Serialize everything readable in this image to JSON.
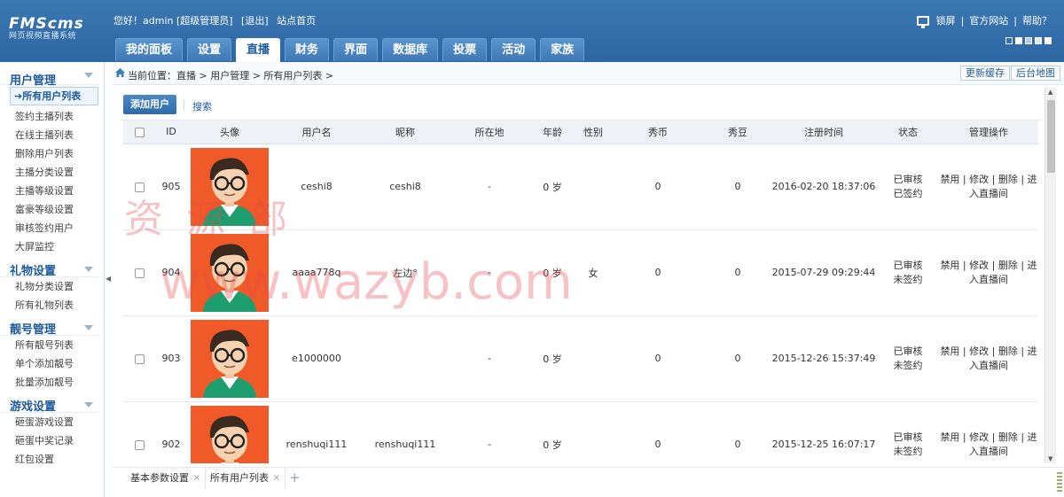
{
  "header": {
    "logo_title": "FMScms",
    "logo_subtitle": "网页视频直播系统",
    "welcome": "您好！admin [超级管理员]",
    "logout": "[退出]",
    "site_home": "站点首页",
    "lock_screen": "锁屏",
    "official_site": "官方网站",
    "help": "帮助？",
    "skin_colors": [
      "#2b73c8",
      "#ffffff",
      "#b7cde6",
      "#e6e6e6",
      "#ffffff"
    ]
  },
  "nav": {
    "tabs": [
      "我的面板",
      "设置",
      "直播",
      "财务",
      "界面",
      "数据库",
      "投票",
      "活动",
      "家族"
    ],
    "active": "直播"
  },
  "sidebar": {
    "sections": [
      {
        "title": "用户管理",
        "items": [
          "所有用户列表",
          "签约主播列表",
          "在线主播列表",
          "删除用户列表",
          "主播分类设置",
          "主播等级设置",
          "富豪等级设置",
          "审核签约用户",
          "大屏监控"
        ]
      },
      {
        "title": "礼物设置",
        "items": [
          "礼物分类设置",
          "所有礼物列表"
        ]
      },
      {
        "title": "靓号管理",
        "items": [
          "所有靓号列表",
          "单个添加靓号",
          "批量添加靓号"
        ]
      },
      {
        "title": "游戏设置",
        "items": [
          "砸蛋游戏设置",
          "砸蛋中奖记录",
          "红包设置"
        ]
      }
    ],
    "active_item": "所有用户列表"
  },
  "breadcrumb": {
    "text": "当前位置：直播 > 用户管理 > 所有用户列表 >",
    "refresh_cache": "更新缓存",
    "site_map": "后台地图"
  },
  "toolbar": {
    "add_user": "添加用户",
    "search": "搜索"
  },
  "table": {
    "headers": [
      "ID",
      "头像",
      "用户名",
      "昵称",
      "所在地",
      "年龄",
      "性别",
      "秀币",
      "秀豆",
      "注册时间",
      "状态",
      "管理操作"
    ],
    "rows": [
      {
        "id": "905",
        "username": "ceshi8",
        "nickname": "ceshi8",
        "location": "-",
        "age": "0 岁",
        "gender": "",
        "coins": "0",
        "beans": "0",
        "registered": "2016-02-20 18:37:06",
        "status1": "已审核",
        "status2": "已签约"
      },
      {
        "id": "904",
        "username": "aaaa778q",
        "nickname": "左边°",
        "location": "-",
        "age": "0 岁",
        "gender": "女",
        "coins": "0",
        "beans": "0",
        "registered": "2015-07-29 09:29:44",
        "status1": "已审核",
        "status2": "未签约"
      },
      {
        "id": "903",
        "username": "e1000000",
        "nickname": "",
        "location": "-",
        "age": "0 岁",
        "gender": "",
        "coins": "0",
        "beans": "0",
        "registered": "2015-12-26 15:37:49",
        "status1": "已审核",
        "status2": "未签约"
      },
      {
        "id": "902",
        "username": "renshuqi111",
        "nickname": "renshuqi111",
        "location": "-",
        "age": "0 岁",
        "gender": "",
        "coins": "0",
        "beans": "0",
        "registered": "2015-12-25 16:07:17",
        "status1": "已审核",
        "status2": "未签约"
      }
    ],
    "ops": {
      "ban": "禁用",
      "edit": "修改",
      "delete": "删除",
      "enter_room": "进入直播间",
      "sep": "|"
    }
  },
  "bottom_tabs": [
    "基本参数设置",
    "所有用户列表"
  ],
  "bottom_close": "×",
  "bottom_add": "+",
  "watermark": {
    "line1": "资源部",
    "line2": "www.wazyb.com"
  },
  "colors": {
    "header_blue": "#2d67a3",
    "link_blue": "#1d5a9b",
    "avatar_bg": "#f05a28",
    "watermark": "#e8454f"
  },
  "icons": [
    "home-icon",
    "monitor-icon",
    "chevron-down-icon",
    "collapse-arrow-icon",
    "close-icon",
    "plus-icon"
  ]
}
